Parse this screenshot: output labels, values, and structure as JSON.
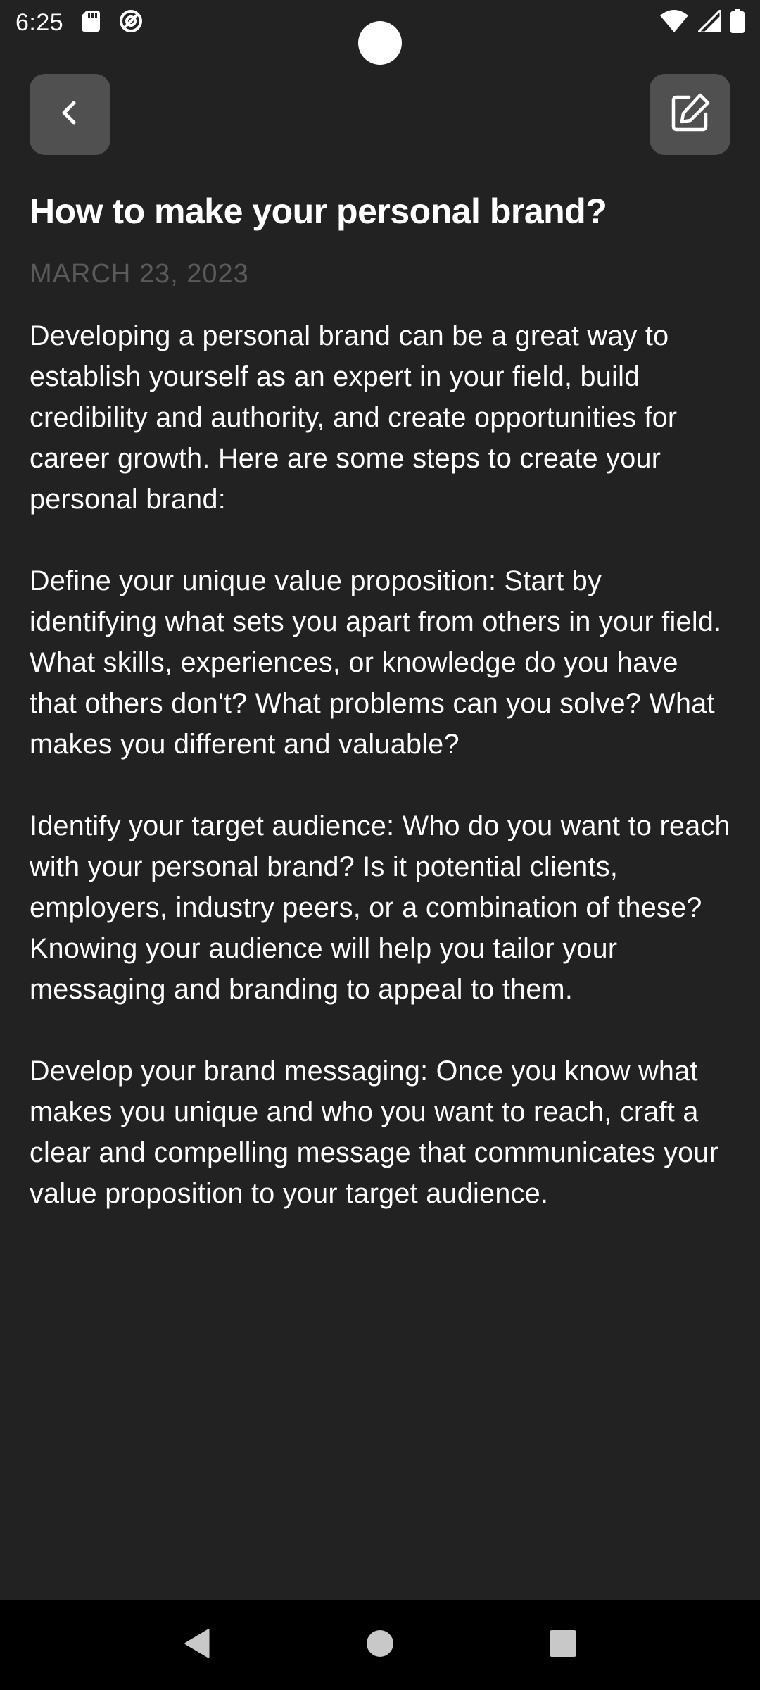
{
  "status_bar": {
    "time": "6:25",
    "left_icons": [
      "sd-card-icon",
      "no-disturb-icon"
    ],
    "right_icons": [
      "wifi-icon",
      "cellular-signal-icon",
      "battery-icon"
    ]
  },
  "header": {
    "back_icon": "chevron-left-icon",
    "edit_icon": "edit-note-icon"
  },
  "note": {
    "title": "How to make your personal brand?",
    "date": "MARCH 23, 2023",
    "paragraphs": [
      "Developing a personal brand can be a great way to establish yourself as an expert in your field, build credibility and authority, and create opportunities for career growth. Here are some steps to create your personal brand:",
      "Define your unique value proposition: Start by identifying what sets you apart from others in your field. What skills, experiences, or knowledge do you have that others don't? What problems can you solve? What makes you different and valuable?",
      "Identify your target audience: Who do you want to reach with your personal brand? Is it potential clients, employers, industry peers, or a combination of these? Knowing your audience will help you tailor your messaging and branding to appeal to them.",
      "Develop your brand messaging: Once you know what makes you unique and who you want to reach, craft a clear and compelling message that communicates your value proposition to your target audience."
    ]
  },
  "nav_bar": {
    "buttons": [
      "back-triangle-icon",
      "home-circle-icon",
      "recents-square-icon"
    ]
  },
  "colors": {
    "background": "#222222",
    "button_bg": "#505050",
    "date_text": "#5a5a5a",
    "nav_bg": "#000000"
  }
}
